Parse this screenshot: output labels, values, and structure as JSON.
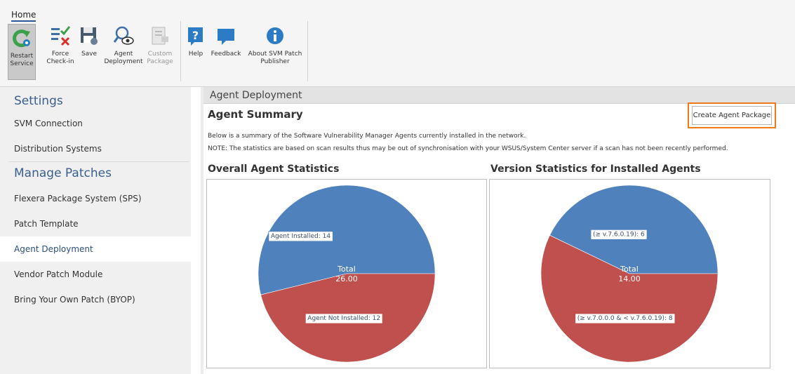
{
  "ribbon": {
    "tab": "Home",
    "buttons": [
      {
        "label1": "Restart",
        "label2": "Service"
      },
      {
        "label1": "Force",
        "label2": "Check-in"
      },
      {
        "label1": "Save",
        "label2": ""
      },
      {
        "label1": "Agent",
        "label2": "Deployment"
      },
      {
        "label1": "Custom",
        "label2": "Package"
      },
      {
        "label1": "Help",
        "label2": ""
      },
      {
        "label1": "Feedback",
        "label2": ""
      },
      {
        "label1": "About SVM Patch",
        "label2": "Publisher"
      }
    ]
  },
  "sidebar": {
    "settings_header": "Settings",
    "settings_items": [
      "SVM Connection",
      "Distribution Systems"
    ],
    "patches_header": "Manage Patches",
    "patches_items": [
      "Flexera Package System (SPS)",
      "Patch Template",
      "Agent Deployment",
      "Vendor Patch Module",
      "Bring Your Own Patch (BYOP)"
    ],
    "selected": "Agent Deployment"
  },
  "main": {
    "header": "Agent Deployment",
    "summary_title": "Agent Summary",
    "create_button": "Create Agent Package",
    "description": "Below is a summary of the Software Vulnerability Manager Agents currently installed in the network.",
    "note": "NOTE: The statistics are based on scan results thus may be out of synchronisation with your WSUS/System Center server if a scan has not been recently performed."
  },
  "chart_data": [
    {
      "type": "pie",
      "title": "Overall Agent Statistics",
      "labels": [
        "Agent Installed",
        "Agent Not Installed"
      ],
      "values": [
        14,
        12
      ],
      "slice_labels": [
        "Agent Installed: 14",
        "Agent Not Installed: 12"
      ],
      "center_label": "Total",
      "center_value": "26.00",
      "colors": [
        "#4f81bd",
        "#c0504d"
      ]
    },
    {
      "type": "pie",
      "title": "Version Statistics for Installed Agents",
      "labels": [
        "(≥ v.7.6.0.19)",
        "(≥ v.7.0.0.0 & < v.7.6.0.19)"
      ],
      "values": [
        6,
        8
      ],
      "slice_labels": [
        "(≥ v.7.6.0.19): 6",
        "(≥ v.7.0.0.0 & < v.7.6.0.19): 8"
      ],
      "center_label": "Total",
      "center_value": "14.00",
      "colors": [
        "#4f81bd",
        "#c0504d"
      ]
    }
  ]
}
